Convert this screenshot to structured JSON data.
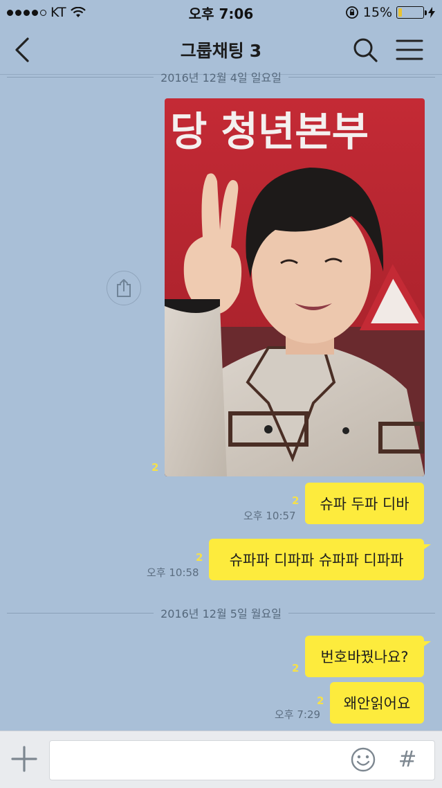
{
  "status_bar": {
    "carrier": "KT",
    "time": "오후 7:06",
    "battery_text": "15%",
    "battery_level": 0.15
  },
  "header": {
    "title": "그룹채팅",
    "member_count": "3",
    "icons": {
      "back": "back-chevron-icon",
      "search": "search-icon",
      "menu": "menu-icon"
    }
  },
  "dividers": [
    {
      "label": "2016년 12월 4일 일요일"
    },
    {
      "label": "2016년 12월 5일 월요일"
    }
  ],
  "photo_message": {
    "unread": "2",
    "photo_text": "당 청년본부",
    "share_icon": "share-icon"
  },
  "messages": [
    {
      "text": "슈파 두파 디바",
      "unread": "2",
      "time": "오후 10:57"
    },
    {
      "text": "슈파파 디파파 슈파파 디파파",
      "unread": "2",
      "time": "오후 10:58"
    },
    {
      "text": "번호바꿨나요?",
      "unread": "2",
      "time": ""
    },
    {
      "text": "왜안읽어요",
      "unread": "2",
      "time": "오후 7:29"
    }
  ],
  "input_bar": {
    "placeholder": "",
    "hash": "#",
    "icons": {
      "plus": "plus-icon",
      "emoji": "emoji-icon"
    }
  },
  "colors": {
    "background": "#a9bfd7",
    "bubble": "#fdeb3d",
    "unread": "#f5e04a"
  }
}
